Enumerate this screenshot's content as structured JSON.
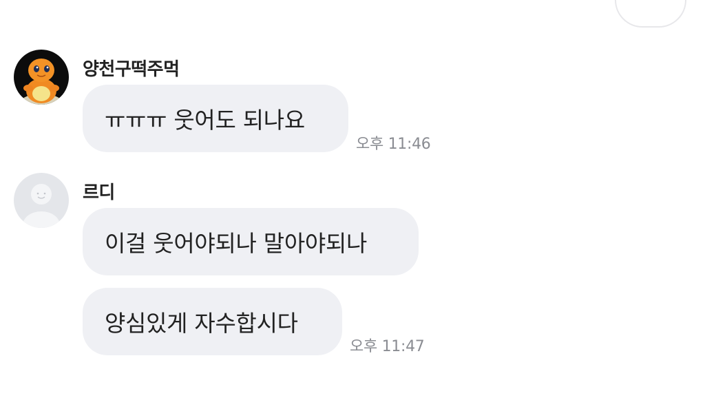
{
  "chat": {
    "messages": [
      {
        "sender": "양천구떡주먹",
        "avatar_icon": "charmander-plush-avatar",
        "texts": [
          "ㅠㅠㅠ 웃어도 되나요"
        ],
        "time": "오후 11:46"
      },
      {
        "sender": "르디",
        "avatar_icon": "default-profile-avatar",
        "texts": [
          "이걸 웃어야되나 말아야되나",
          "양심있게 자수합시다"
        ],
        "time": "오후 11:47"
      }
    ]
  },
  "colors": {
    "bubble_bg": "#eff0f4",
    "text": "#222222",
    "timestamp": "#8a8c92",
    "background": "#ffffff"
  }
}
